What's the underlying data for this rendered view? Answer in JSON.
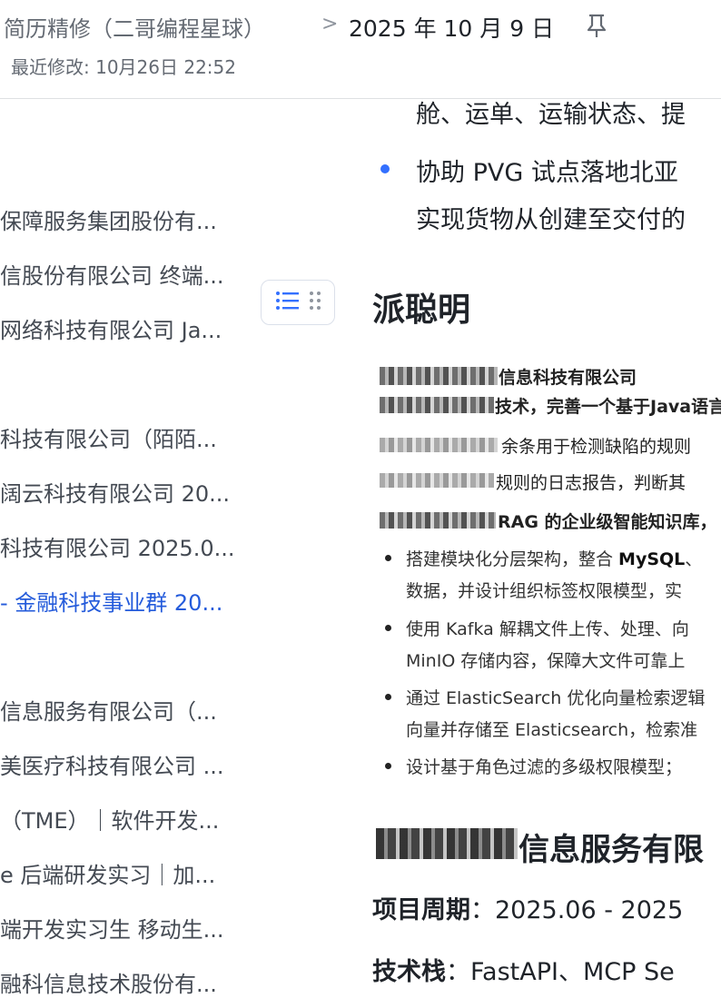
{
  "header": {
    "doc_title": "简历精修（二哥编程星球）",
    "separator": ">",
    "current_page": "2025 年 10 月 9 日",
    "last_modified": "最近修改: 10月26日 22:52"
  },
  "outline": {
    "items": [
      {
        "label": "保障服务集团股份有...",
        "active": false
      },
      {
        "label": "信股份有限公司 终端...",
        "active": false
      },
      {
        "label": "网络科技有限公司 Ja...",
        "active": false
      },
      {
        "label": "科技有限公司（陌陌...",
        "active": false
      },
      {
        "label": "阔云科技有限公司 20...",
        "active": false
      },
      {
        "label": "科技有限公司 2025.0...",
        "active": false
      },
      {
        "label": "- 金融科技事业群 20...",
        "active": true
      },
      {
        "label": "信息服务有限公司（...",
        "active": false
      },
      {
        "label": "美医疗科技有限公司 ...",
        "active": false
      },
      {
        "label": "（TME）｜软件开发...",
        "active": false
      },
      {
        "label": "e 后端研发实习｜加...",
        "active": false
      },
      {
        "label": "端开发实习生 移动生...",
        "active": false
      },
      {
        "label": "融科信息技术股份有...",
        "active": false
      }
    ]
  },
  "content": {
    "top_line": "舱、运单、运输状态、提",
    "bullet_line1": "协助 PVG 试点落地北亚",
    "bullet_line2": "实现货物从创建至交付的",
    "section_heading": "派聪明",
    "image": {
      "line1": "信息科技有限公司",
      "line2": "技术，完善一个基于Java语言",
      "line3": "余条用于检测缺陷的规则",
      "line4": "规则的日志报告，判断其",
      "line5": "RAG 的企业级智能知识库，",
      "bullets": [
        {
          "a": "搭建模块化分层架构，整合 ",
          "b": "MySQL",
          "c": "、"
        },
        {
          "a": "数据，并设计组织标签权限模型，实",
          "b": "",
          "c": ""
        },
        {
          "a": "使用 Kafka 解耦文件上传、处理、向",
          "b": "",
          "c": ""
        },
        {
          "a": "MinIO 存储内容，保障大文件可靠上",
          "b": "",
          "c": ""
        },
        {
          "a": "通过 ElasticSearch 优化向量检索逻辑",
          "b": "",
          "c": ""
        },
        {
          "a": "向量并存储至 Elasticsearch，检索准",
          "b": "",
          "c": ""
        },
        {
          "a": "设计基于角色过滤的多级权限模型；",
          "b": "",
          "c": ""
        }
      ]
    },
    "company_heading": "信息服务有限",
    "period_label": "项目周期",
    "period_value": "：2025.06 - 2025",
    "stack_label": "技术栈",
    "stack_value": "：FastAPI、MCP Se"
  },
  "colors": {
    "accent": "#3370ff",
    "active_link": "#245bdb",
    "text": "#1f2329",
    "muted": "#646a73"
  }
}
